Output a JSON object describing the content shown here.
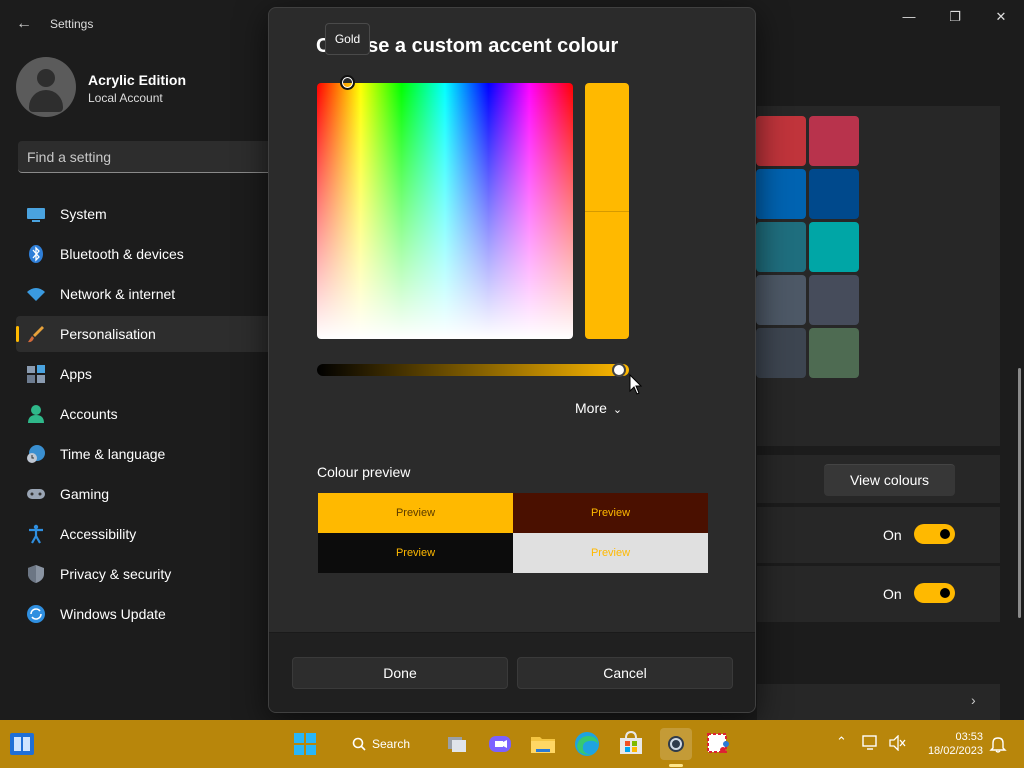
{
  "settings": {
    "app_title": "Settings",
    "user": {
      "name": "Acrylic Edition",
      "account_type": "Local Account"
    },
    "search_placeholder": "Find a setting",
    "nav": [
      {
        "label": "System",
        "icon": "monitor-icon"
      },
      {
        "label": "Bluetooth & devices",
        "icon": "bluetooth-icon"
      },
      {
        "label": "Network & internet",
        "icon": "wifi-icon"
      },
      {
        "label": "Personalisation",
        "icon": "brush-icon",
        "active": true
      },
      {
        "label": "Apps",
        "icon": "apps-icon"
      },
      {
        "label": "Accounts",
        "icon": "person-icon"
      },
      {
        "label": "Time & language",
        "icon": "globe-clock-icon"
      },
      {
        "label": "Gaming",
        "icon": "gamepad-icon"
      },
      {
        "label": "Accessibility",
        "icon": "accessibility-icon"
      },
      {
        "label": "Privacy & security",
        "icon": "shield-icon"
      },
      {
        "label": "Windows Update",
        "icon": "update-icon"
      }
    ],
    "view_colours_label": "View colours",
    "toggle_1_label": "On",
    "toggle_2_label": "On",
    "accent_swatches": [
      "#c0343b",
      "#b8334c",
      "#0063b1",
      "#00498c",
      "#1f6e7e",
      "#00a6a6",
      "#4d5866",
      "#464c5b",
      "#3d4550",
      "#4e6b52"
    ]
  },
  "dialog": {
    "title": "Choose a custom accent colour",
    "tooltip": "Gold",
    "selected_colour": "#ffb900",
    "value_level": 0.98,
    "more_label": "More",
    "preview_label": "Colour preview",
    "previews": [
      {
        "text": "Preview",
        "bg": "#ffb900",
        "fg": "#5a3a00"
      },
      {
        "text": "Preview",
        "bg": "#4a1000",
        "fg": "#ffb900"
      },
      {
        "text": "Preview",
        "bg": "#0c0c0c",
        "fg": "#ffb900"
      },
      {
        "text": "Preview",
        "bg": "#e0e0e0",
        "fg": "#ffb900"
      }
    ],
    "done_label": "Done",
    "cancel_label": "Cancel"
  },
  "taskbar": {
    "search_label": "Search",
    "time": "03:53",
    "date": "18/02/2023",
    "color": "#b8860b"
  }
}
